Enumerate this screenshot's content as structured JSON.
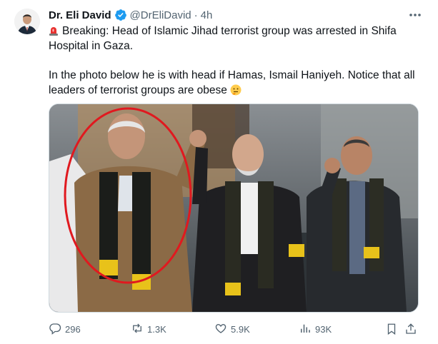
{
  "author": {
    "name": "Dr. Eli David",
    "handle": "@DrEliDavid",
    "separator": "·",
    "time": "4h"
  },
  "tweet": {
    "line1": "Breaking: Head of Islamic Jihad terrorist group was arrested in Shifa Hospital in Gaza.",
    "line2": "In the photo below he is with head if Hamas, Ismail Haniyeh. Notice that all leaders of terrorist groups are obese"
  },
  "icons": {
    "verified": "verified-badge-icon",
    "more": "more-icon",
    "siren": "police-light-emoji",
    "thinking": "thinking-face-emoji",
    "reply": "reply-icon",
    "retweet": "retweet-icon",
    "like": "like-icon",
    "views": "views-icon",
    "bookmark": "bookmark-icon",
    "share": "share-icon"
  },
  "stats": {
    "replies": "296",
    "retweets": "1.3K",
    "likes": "5.9K",
    "views": "93K"
  },
  "colors": {
    "accent": "#1d9bf0",
    "muted": "#536471",
    "circle": "#e0191f"
  }
}
